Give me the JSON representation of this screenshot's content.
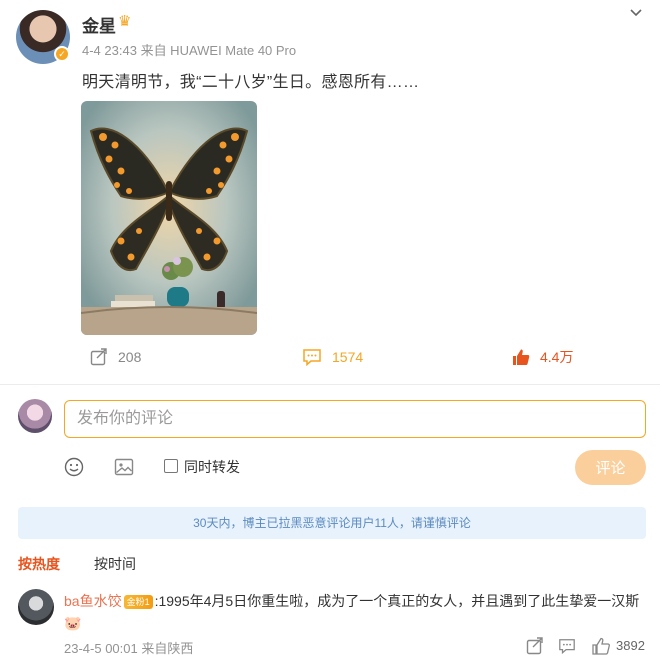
{
  "post": {
    "username": "金星",
    "crown_icon": "crown-icon",
    "timestamp": "4-4 23:43",
    "source": "来自 HUAWEI Mate 40 Pro",
    "text": "明天清明节，我“二十八岁”生日。感恩所有……",
    "actions": {
      "repost_count": "208",
      "comment_count": "1574",
      "like_count": "4.4万"
    }
  },
  "composer": {
    "placeholder": "发布你的评论",
    "also_repost_label": "同时转发",
    "submit_label": "评论"
  },
  "notice": "30天内，博主已拉黑恶意评论用户11人，请谨慎评论",
  "tabs": {
    "hot": "按热度",
    "time": "按时间"
  },
  "comment": {
    "author": "ba鱼水饺",
    "badge": "金粉1",
    "text": ":1995年4月5日你重生啦，成为了一个真正的女人，并且遇到了此生挚爱一汉斯",
    "emoji": "🐷",
    "meta": "23-4-5 00:01 来自陕西",
    "like_count": "3892"
  },
  "colors": {
    "accent": "#f5a623",
    "like": "#e8541e",
    "notice_bg": "#e8f2fc",
    "notice_text": "#5b8bc1"
  }
}
